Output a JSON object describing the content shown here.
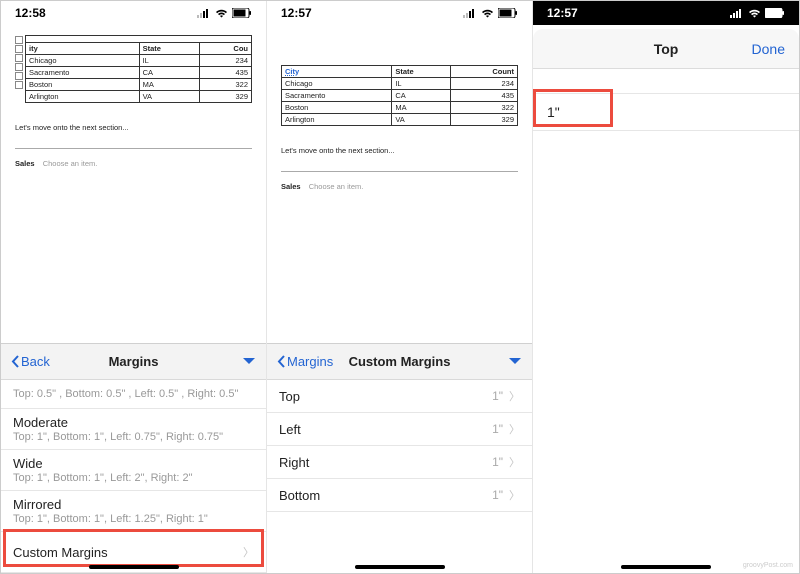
{
  "panels": {
    "left": {
      "time": "12:58",
      "table": {
        "headers": [
          "ity",
          "State",
          "Cou"
        ],
        "rows": [
          [
            "Chicago",
            "IL",
            "234"
          ],
          [
            "Sacramento",
            "CA",
            "435"
          ],
          [
            "Boston",
            "MA",
            "322"
          ],
          [
            "Arlington",
            "VA",
            "329"
          ]
        ]
      },
      "doc_text": "Let's move onto the next section...",
      "sales_label": "Sales",
      "sales_pick": "Choose an item.",
      "margins_header": {
        "back": "Back",
        "title": "Margins"
      },
      "margin_options": [
        {
          "key": "truncated",
          "primary": "Top: 0.5\" , Bottom: 0.5\" , Left: 0.5\" , Right: 0.5\"",
          "secondary": ""
        },
        {
          "key": "moderate",
          "primary": "Moderate",
          "secondary": "Top: 1\", Bottom: 1\", Left: 0.75\", Right: 0.75\""
        },
        {
          "key": "wide",
          "primary": "Wide",
          "secondary": "Top: 1\", Bottom: 1\", Left: 2\", Right: 2\""
        },
        {
          "key": "mirrored",
          "primary": "Mirrored",
          "secondary": "Top: 1\", Bottom: 1\", Left: 1.25\", Right: 1\""
        },
        {
          "key": "custom",
          "primary": "Custom Margins",
          "secondary": ""
        }
      ]
    },
    "mid": {
      "time": "12:57",
      "table": {
        "headers": [
          "City",
          "State",
          "Count"
        ],
        "rows": [
          [
            "Chicago",
            "IL",
            "234"
          ],
          [
            "Sacramento",
            "CA",
            "435"
          ],
          [
            "Boston",
            "MA",
            "322"
          ],
          [
            "Arlington",
            "VA",
            "329"
          ]
        ]
      },
      "doc_text": "Let's move onto the next section...",
      "sales_label": "Sales",
      "sales_pick": "Choose an item.",
      "custom_header": {
        "back": "Margins",
        "title": "Custom Margins"
      },
      "custom_rows": [
        {
          "label": "Top",
          "value": "1\""
        },
        {
          "label": "Left",
          "value": "1\""
        },
        {
          "label": "Right",
          "value": "1\""
        },
        {
          "label": "Bottom",
          "value": "1\""
        }
      ]
    },
    "right": {
      "time": "12:57",
      "header_title": "Top",
      "done": "Done",
      "field_value": "1\""
    }
  },
  "watermark": "groovyPost.com"
}
